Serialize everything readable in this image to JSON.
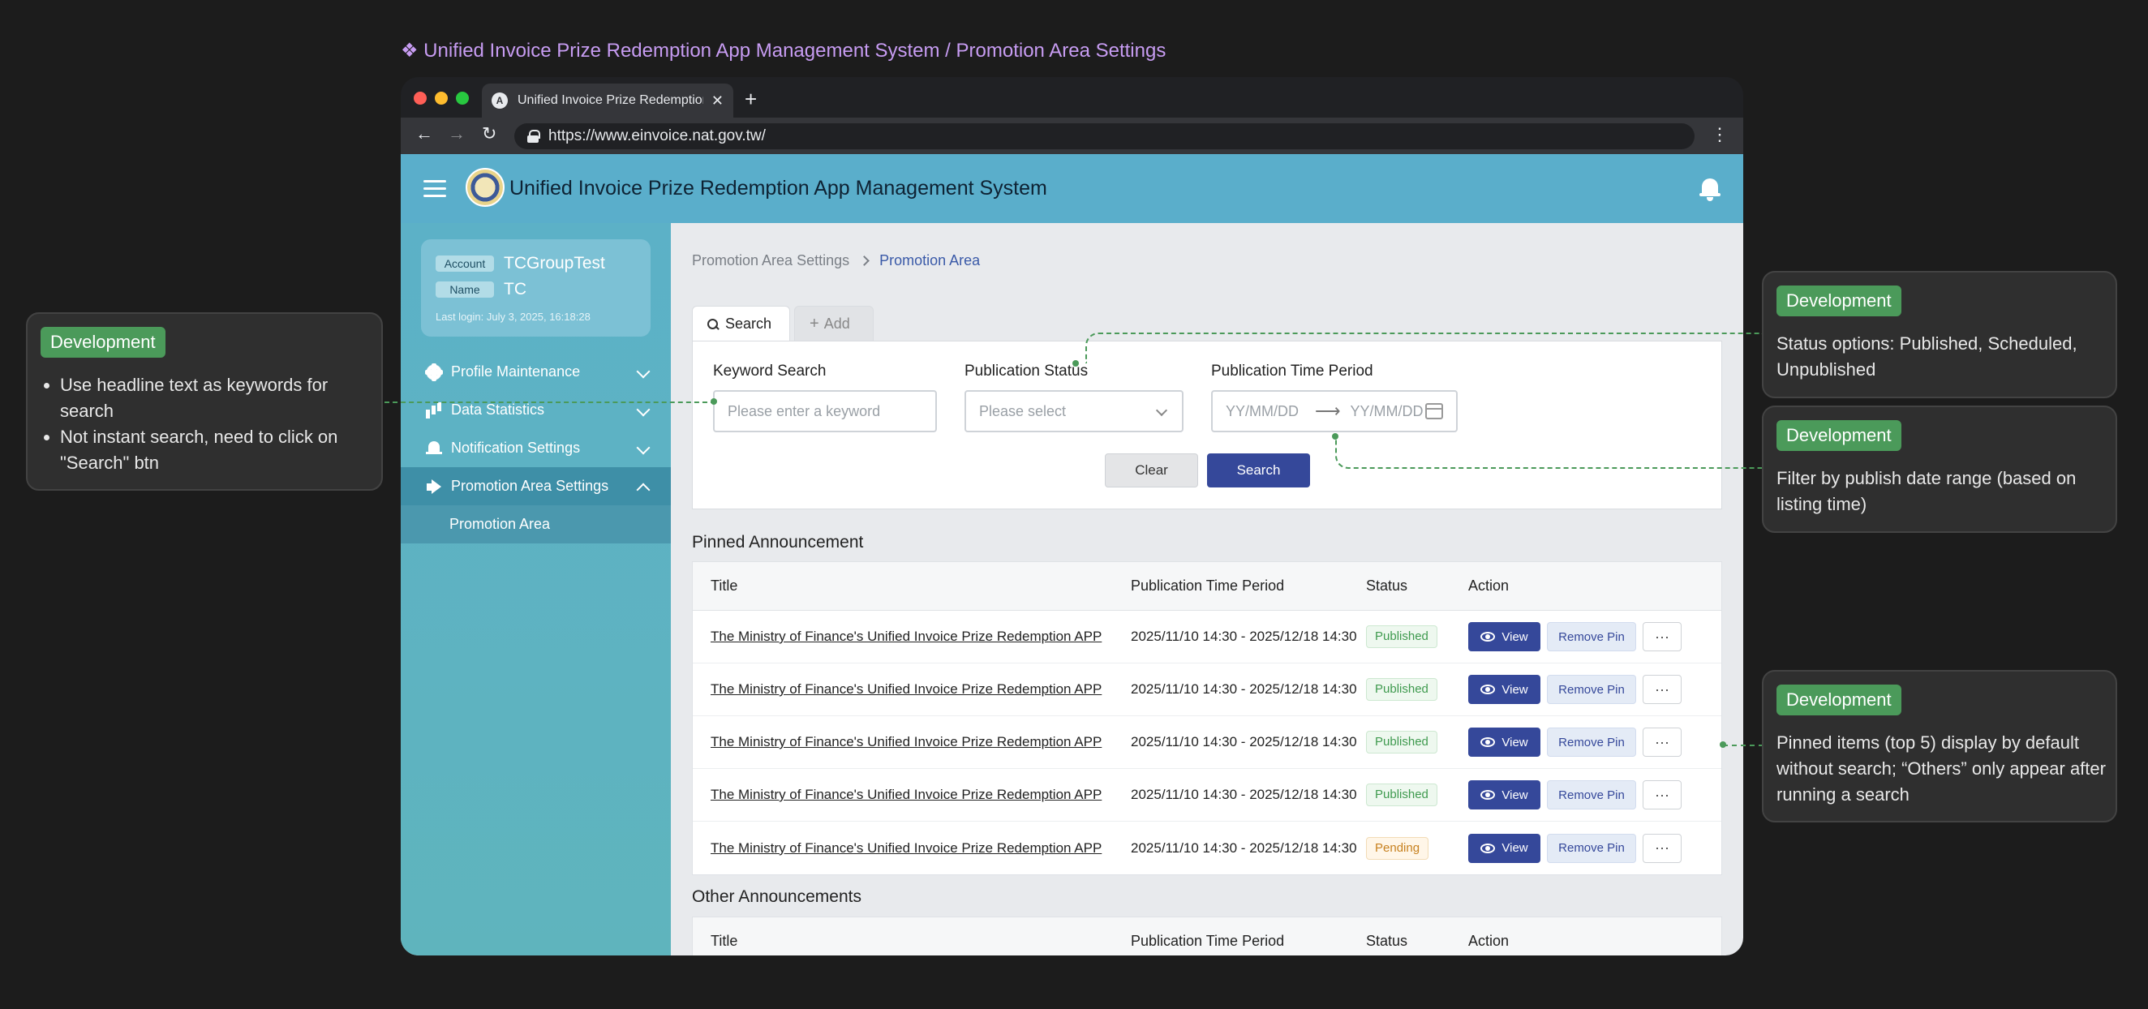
{
  "caption": "❖ Unified Invoice Prize Redemption App Management System / Promotion Area Settings",
  "browser": {
    "tab_title": "Unified Invoice Prize Redemption App Management System",
    "tab_favicon_letter": "A",
    "url": "https://www.einvoice.nat.gov.tw/"
  },
  "app": {
    "title": "Unified Invoice Prize Redemption App Management System"
  },
  "user": {
    "account_label": "Account",
    "account_value": "TCGroupTest",
    "name_label": "Name",
    "name_value": "TC",
    "last_login": "Last login: July 3, 2025, 16:18:28"
  },
  "sidebar": {
    "items": [
      {
        "label": "Profile Maintenance",
        "icon": "gear-icon"
      },
      {
        "label": "Data Statistics",
        "icon": "bar-chart-icon"
      },
      {
        "label": "Notification Settings",
        "icon": "bell-icon"
      },
      {
        "label": "Promotion Area Settings",
        "icon": "megaphone-icon"
      }
    ],
    "subitem": "Promotion Area"
  },
  "breadcrumb": {
    "parent": "Promotion Area Settings",
    "current": "Promotion Area"
  },
  "tabs": {
    "search": "Search",
    "add": "Add"
  },
  "search_form": {
    "keyword_label": "Keyword Search",
    "keyword_placeholder": "Please enter a keyword",
    "status_label": "Publication Status",
    "status_placeholder": "Please select",
    "period_label": "Publication Time Period",
    "date_from_placeholder": "YY/MM/DD",
    "date_to_placeholder": "YY/MM/DD",
    "clear_button": "Clear",
    "search_button": "Search"
  },
  "pinned": {
    "heading": "Pinned Announcement",
    "columns": [
      "Title",
      "Publication Time Period",
      "Status",
      "Action"
    ],
    "rows": [
      {
        "title": "The Ministry of Finance's Unified Invoice Prize Redemption APP",
        "period": "2025/11/10 14:30 - 2025/12/18 14:30",
        "status": "Published",
        "status_kind": "published"
      },
      {
        "title": "The Ministry of Finance's Unified Invoice Prize Redemption APP",
        "period": "2025/11/10 14:30 - 2025/12/18 14:30",
        "status": "Published",
        "status_kind": "published"
      },
      {
        "title": "The Ministry of Finance's Unified Invoice Prize Redemption APP",
        "period": "2025/11/10 14:30 - 2025/12/18 14:30",
        "status": "Published",
        "status_kind": "published"
      },
      {
        "title": "The Ministry of Finance's Unified Invoice Prize Redemption APP",
        "period": "2025/11/10 14:30 - 2025/12/18 14:30",
        "status": "Published",
        "status_kind": "published"
      },
      {
        "title": "The Ministry of Finance's Unified Invoice Prize Redemption APP",
        "period": "2025/11/10 14:30 - 2025/12/18 14:30",
        "status": "Pending",
        "status_kind": "pending"
      }
    ],
    "actions": {
      "view": "View",
      "unpin": "Remove Pin",
      "more": "···"
    }
  },
  "others": {
    "heading": "Other Announcements",
    "columns": [
      "Title",
      "Publication Time Period",
      "Status",
      "Action"
    ]
  },
  "notes": {
    "badge": "Development",
    "keyword_note": [
      "Use headline text as keywords for search",
      "Not instant search, need to click on \"Search\" btn"
    ],
    "status_note": "Status options: Published, Scheduled, Unpublished",
    "date_note": "Filter by publish date range (based on listing time)",
    "pinned_note": "Pinned items (top 5) display by default without search; “Others” only appear after running a search"
  },
  "colors": {
    "header": "#5aaecb",
    "sidebar": "#5cb1c7",
    "primary_button": "#35489a",
    "note_badge": "#4b9a5a",
    "caption": "#c79cf2"
  }
}
